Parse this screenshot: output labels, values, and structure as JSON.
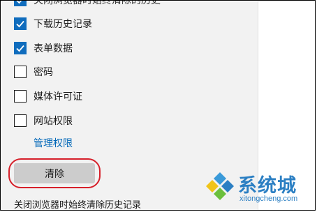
{
  "settings": {
    "top_partial_label": "关闭浏览器时始终清除的历史",
    "items": [
      {
        "label": "下载历史记录",
        "checked": true
      },
      {
        "label": "表单数据",
        "checked": true
      },
      {
        "label": "密码",
        "checked": false
      },
      {
        "label": "媒体许可证",
        "checked": false
      },
      {
        "label": "网站权限",
        "checked": false
      }
    ],
    "manage_link": "管理权限",
    "clear_button": "清除",
    "footer_text": "关闭浏览器时始终清除历史记录"
  },
  "watermark": {
    "brand": "系统城",
    "url": "xitongcheng.com"
  },
  "colors": {
    "accent": "#0f6cbd",
    "link": "#0067b8",
    "highlight_ring": "#d6202a",
    "panel_bg": "#f2f2f2",
    "button_bg": "#cccccc",
    "watermark_blue": "#2b7fc3"
  },
  "icons": {
    "checked": "checkmark-icon",
    "watermark_logo": "diamond-logo-icon"
  }
}
